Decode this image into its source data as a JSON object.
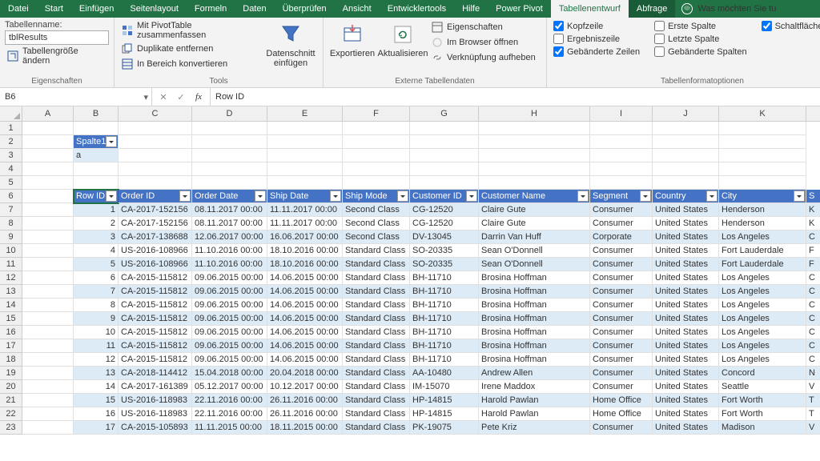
{
  "tabs": [
    "Datei",
    "Start",
    "Einfügen",
    "Seitenlayout",
    "Formeln",
    "Daten",
    "Überprüfen",
    "Ansicht",
    "Entwicklertools",
    "Hilfe",
    "Power Pivot",
    "Tabellenentwurf",
    "Abfrage"
  ],
  "tell_me": "Was möchten Sie tu",
  "ribbon": {
    "props": {
      "label": "Tabellenname:",
      "value": "tblResults",
      "resize": "Tabellengröße ändern",
      "group": "Eigenschaften"
    },
    "tools": {
      "pivot": "Mit PivotTable zusammenfassen",
      "dup": "Duplikate entfernen",
      "range": "In Bereich konvertieren",
      "slicer": "Datenschnitt einfügen",
      "group": "Tools"
    },
    "ext": {
      "export": "Exportieren",
      "refresh": "Aktualisieren",
      "props": "Eigenschaften",
      "browser": "Im Browser öffnen",
      "unlink": "Verknüpfung aufheben",
      "group": "Externe Tabellendaten"
    },
    "style": {
      "header": "Kopfzeile",
      "total": "Ergebniszeile",
      "bandr": "Gebänderte Zeilen",
      "first": "Erste Spalte",
      "last": "Letzte Spalte",
      "bandc": "Gebänderte Spalten",
      "filter": "Schaltfläche \"Filter\"",
      "group": "Tabellenformatoptionen"
    }
  },
  "namebox": "B6",
  "formula": "Row ID",
  "cols": [
    "A",
    "B",
    "C",
    "D",
    "E",
    "F",
    "G",
    "H",
    "I",
    "J",
    "K"
  ],
  "widths": [
    64,
    56,
    92,
    94,
    94,
    84,
    86,
    139,
    78,
    83,
    109
  ],
  "rownums": [
    1,
    2,
    3,
    4,
    5,
    6,
    7,
    8,
    9,
    10,
    11,
    12,
    13,
    14,
    15,
    16,
    17,
    18,
    19,
    20,
    21,
    22,
    23
  ],
  "spalte1": {
    "hdr": "Spalte1",
    "val": "a"
  },
  "theaders": [
    "Row ID",
    "Order ID",
    "Order Date",
    "Ship Date",
    "Ship Mode",
    "Customer ID",
    "Customer Name",
    "Segment",
    "Country",
    "City"
  ],
  "rows": [
    {
      "id": 1,
      "oid": "CA-2017-152156",
      "od": "08.11.2017 00:00",
      "sd": "11.11.2017 00:00",
      "sm": "Second Class",
      "cid": "CG-12520",
      "cn": "Claire Gute",
      "seg": "Consumer",
      "c": "United States",
      "city": "Henderson",
      "s": "K"
    },
    {
      "id": 2,
      "oid": "CA-2017-152156",
      "od": "08.11.2017 00:00",
      "sd": "11.11.2017 00:00",
      "sm": "Second Class",
      "cid": "CG-12520",
      "cn": "Claire Gute",
      "seg": "Consumer",
      "c": "United States",
      "city": "Henderson",
      "s": "K"
    },
    {
      "id": 3,
      "oid": "CA-2017-138688",
      "od": "12.06.2017 00:00",
      "sd": "16.06.2017 00:00",
      "sm": "Second Class",
      "cid": "DV-13045",
      "cn": "Darrin Van Huff",
      "seg": "Corporate",
      "c": "United States",
      "city": "Los Angeles",
      "s": "C"
    },
    {
      "id": 4,
      "oid": "US-2016-108966",
      "od": "11.10.2016 00:00",
      "sd": "18.10.2016 00:00",
      "sm": "Standard Class",
      "cid": "SO-20335",
      "cn": "Sean O'Donnell",
      "seg": "Consumer",
      "c": "United States",
      "city": "Fort Lauderdale",
      "s": "F"
    },
    {
      "id": 5,
      "oid": "US-2016-108966",
      "od": "11.10.2016 00:00",
      "sd": "18.10.2016 00:00",
      "sm": "Standard Class",
      "cid": "SO-20335",
      "cn": "Sean O'Donnell",
      "seg": "Consumer",
      "c": "United States",
      "city": "Fort Lauderdale",
      "s": "F"
    },
    {
      "id": 6,
      "oid": "CA-2015-115812",
      "od": "09.06.2015 00:00",
      "sd": "14.06.2015 00:00",
      "sm": "Standard Class",
      "cid": "BH-11710",
      "cn": "Brosina Hoffman",
      "seg": "Consumer",
      "c": "United States",
      "city": "Los Angeles",
      "s": "C"
    },
    {
      "id": 7,
      "oid": "CA-2015-115812",
      "od": "09.06.2015 00:00",
      "sd": "14.06.2015 00:00",
      "sm": "Standard Class",
      "cid": "BH-11710",
      "cn": "Brosina Hoffman",
      "seg": "Consumer",
      "c": "United States",
      "city": "Los Angeles",
      "s": "C"
    },
    {
      "id": 8,
      "oid": "CA-2015-115812",
      "od": "09.06.2015 00:00",
      "sd": "14.06.2015 00:00",
      "sm": "Standard Class",
      "cid": "BH-11710",
      "cn": "Brosina Hoffman",
      "seg": "Consumer",
      "c": "United States",
      "city": "Los Angeles",
      "s": "C"
    },
    {
      "id": 9,
      "oid": "CA-2015-115812",
      "od": "09.06.2015 00:00",
      "sd": "14.06.2015 00:00",
      "sm": "Standard Class",
      "cid": "BH-11710",
      "cn": "Brosina Hoffman",
      "seg": "Consumer",
      "c": "United States",
      "city": "Los Angeles",
      "s": "C"
    },
    {
      "id": 10,
      "oid": "CA-2015-115812",
      "od": "09.06.2015 00:00",
      "sd": "14.06.2015 00:00",
      "sm": "Standard Class",
      "cid": "BH-11710",
      "cn": "Brosina Hoffman",
      "seg": "Consumer",
      "c": "United States",
      "city": "Los Angeles",
      "s": "C"
    },
    {
      "id": 11,
      "oid": "CA-2015-115812",
      "od": "09.06.2015 00:00",
      "sd": "14.06.2015 00:00",
      "sm": "Standard Class",
      "cid": "BH-11710",
      "cn": "Brosina Hoffman",
      "seg": "Consumer",
      "c": "United States",
      "city": "Los Angeles",
      "s": "C"
    },
    {
      "id": 12,
      "oid": "CA-2015-115812",
      "od": "09.06.2015 00:00",
      "sd": "14.06.2015 00:00",
      "sm": "Standard Class",
      "cid": "BH-11710",
      "cn": "Brosina Hoffman",
      "seg": "Consumer",
      "c": "United States",
      "city": "Los Angeles",
      "s": "C"
    },
    {
      "id": 13,
      "oid": "CA-2018-114412",
      "od": "15.04.2018 00:00",
      "sd": "20.04.2018 00:00",
      "sm": "Standard Class",
      "cid": "AA-10480",
      "cn": "Andrew Allen",
      "seg": "Consumer",
      "c": "United States",
      "city": "Concord",
      "s": "N"
    },
    {
      "id": 14,
      "oid": "CA-2017-161389",
      "od": "05.12.2017 00:00",
      "sd": "10.12.2017 00:00",
      "sm": "Standard Class",
      "cid": "IM-15070",
      "cn": "Irene Maddox",
      "seg": "Consumer",
      "c": "United States",
      "city": "Seattle",
      "s": "V"
    },
    {
      "id": 15,
      "oid": "US-2016-118983",
      "od": "22.11.2016 00:00",
      "sd": "26.11.2016 00:00",
      "sm": "Standard Class",
      "cid": "HP-14815",
      "cn": "Harold Pawlan",
      "seg": "Home Office",
      "c": "United States",
      "city": "Fort Worth",
      "s": "T"
    },
    {
      "id": 16,
      "oid": "US-2016-118983",
      "od": "22.11.2016 00:00",
      "sd": "26.11.2016 00:00",
      "sm": "Standard Class",
      "cid": "HP-14815",
      "cn": "Harold Pawlan",
      "seg": "Home Office",
      "c": "United States",
      "city": "Fort Worth",
      "s": "T"
    },
    {
      "id": 17,
      "oid": "CA-2015-105893",
      "od": "11.11.2015 00:00",
      "sd": "18.11.2015 00:00",
      "sm": "Standard Class",
      "cid": "PK-19075",
      "cn": "Pete Kriz",
      "seg": "Consumer",
      "c": "United States",
      "city": "Madison",
      "s": "V"
    }
  ]
}
